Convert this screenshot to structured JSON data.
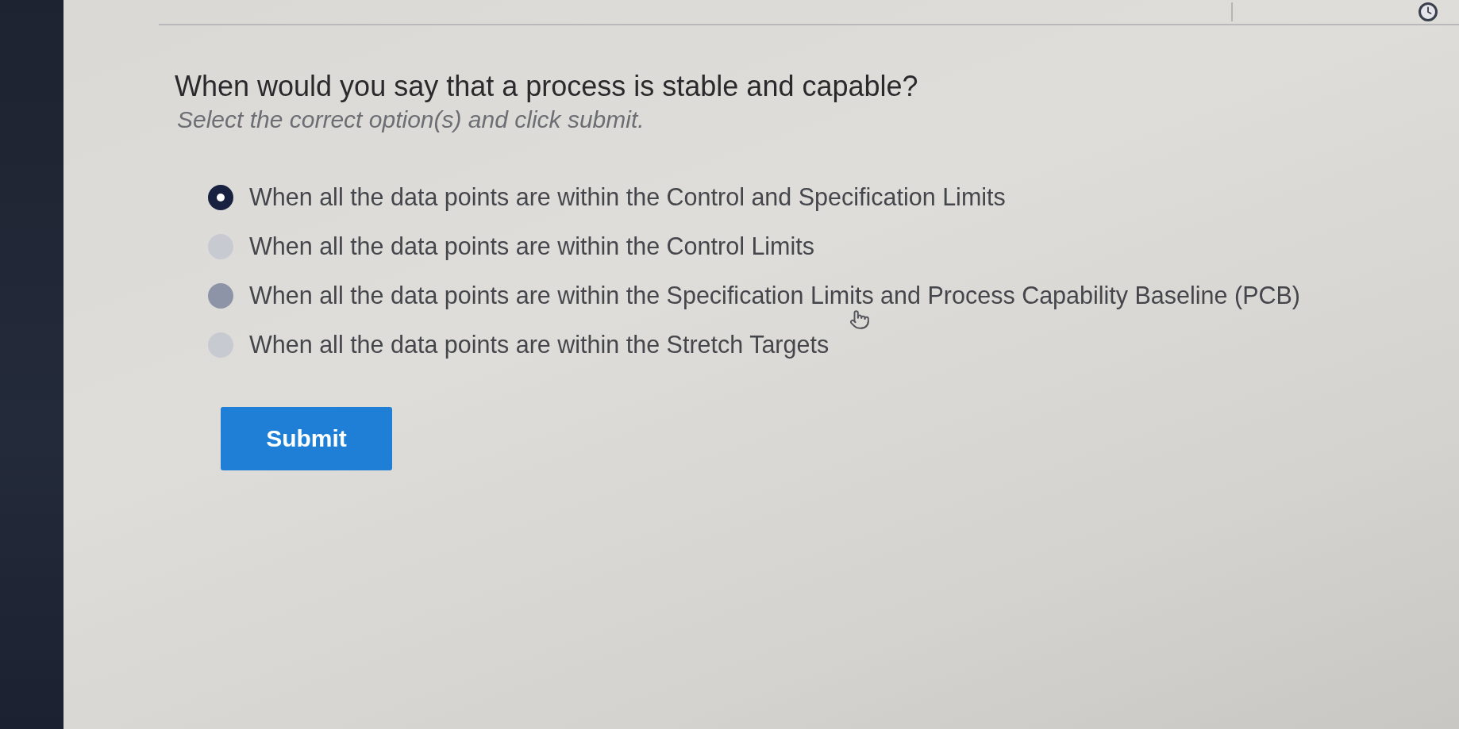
{
  "question": {
    "title": "When would you say that a process is stable and capable?",
    "instruction": "Select the correct option(s) and click submit."
  },
  "options": [
    {
      "label": "When all the data points are within the Control and Specification Limits",
      "selected": true,
      "hovered": false
    },
    {
      "label": "When all the data points are within the Control Limits",
      "selected": false,
      "hovered": false
    },
    {
      "label": "When all the data points are within the Specification Limits and Process Capability Baseline (PCB)",
      "selected": false,
      "hovered": true
    },
    {
      "label": "When all the data points are within the Stretch Targets",
      "selected": false,
      "hovered": false
    }
  ],
  "submit_button": {
    "label": "Submit"
  }
}
